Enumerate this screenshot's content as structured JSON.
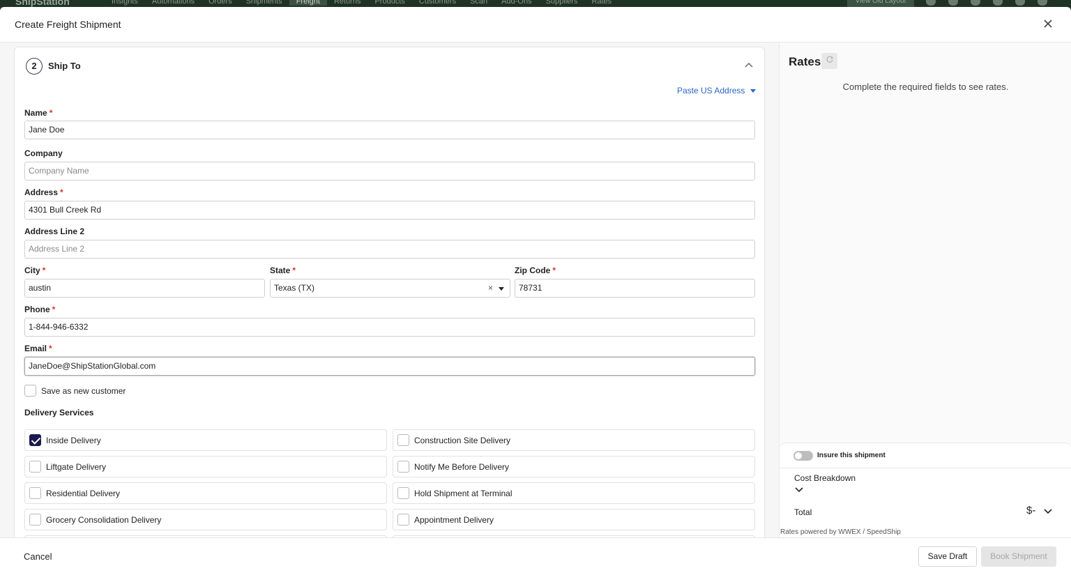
{
  "appbar": {
    "logo": "ShipStation",
    "nav": [
      "Insights",
      "Automations",
      "Orders",
      "Shipments",
      "Freight",
      "Returns",
      "Products",
      "Customers",
      "Scan",
      "Add-Ons",
      "Suppliers",
      "Rates"
    ],
    "active_nav": "Freight",
    "old_layout": "View Old Layout"
  },
  "modal": {
    "title": "Create Freight Shipment"
  },
  "ship_to": {
    "step_number": "2",
    "title": "Ship To",
    "paste_link": "Paste US Address",
    "fields": {
      "name": {
        "label": "Name",
        "value": "Jane Doe"
      },
      "company": {
        "label": "Company",
        "placeholder": "Company Name"
      },
      "address": {
        "label": "Address",
        "value": "4301 Bull Creek Rd"
      },
      "address2": {
        "label": "Address Line 2",
        "placeholder": "Address Line 2"
      },
      "city": {
        "label": "City",
        "value": "austin"
      },
      "state": {
        "label": "State",
        "value": "Texas (TX)"
      },
      "zip": {
        "label": "Zip Code",
        "value": "78731"
      },
      "phone": {
        "label": "Phone",
        "value": "1-844-946-6332"
      },
      "email": {
        "label": "Email",
        "value": "JaneDoe@ShipStationGlobal.com"
      }
    },
    "save_customer": "Save as new customer",
    "required_mark": "*",
    "delivery_services_label": "Delivery Services",
    "services": [
      {
        "label": "Inside Delivery",
        "checked": true
      },
      {
        "label": "Construction Site Delivery",
        "checked": false
      },
      {
        "label": "Liftgate Delivery",
        "checked": false
      },
      {
        "label": "Notify Me Before Delivery",
        "checked": false
      },
      {
        "label": "Residential Delivery",
        "checked": false
      },
      {
        "label": "Hold Shipment at Terminal",
        "checked": false
      },
      {
        "label": "Grocery Consolidation Delivery",
        "checked": false
      },
      {
        "label": "Appointment Delivery",
        "checked": false
      }
    ]
  },
  "rates": {
    "title": "Rates",
    "message": "Complete the required fields to see rates.",
    "insure_label": "Insure this shipment",
    "cost_breakdown": "Cost Breakdown",
    "total_label": "Total",
    "total_value": "$-",
    "powered_by": "Rates powered by WWEX / SpeedShip"
  },
  "footer": {
    "cancel": "Cancel",
    "save_draft": "Save Draft",
    "book": "Book Shipment"
  }
}
